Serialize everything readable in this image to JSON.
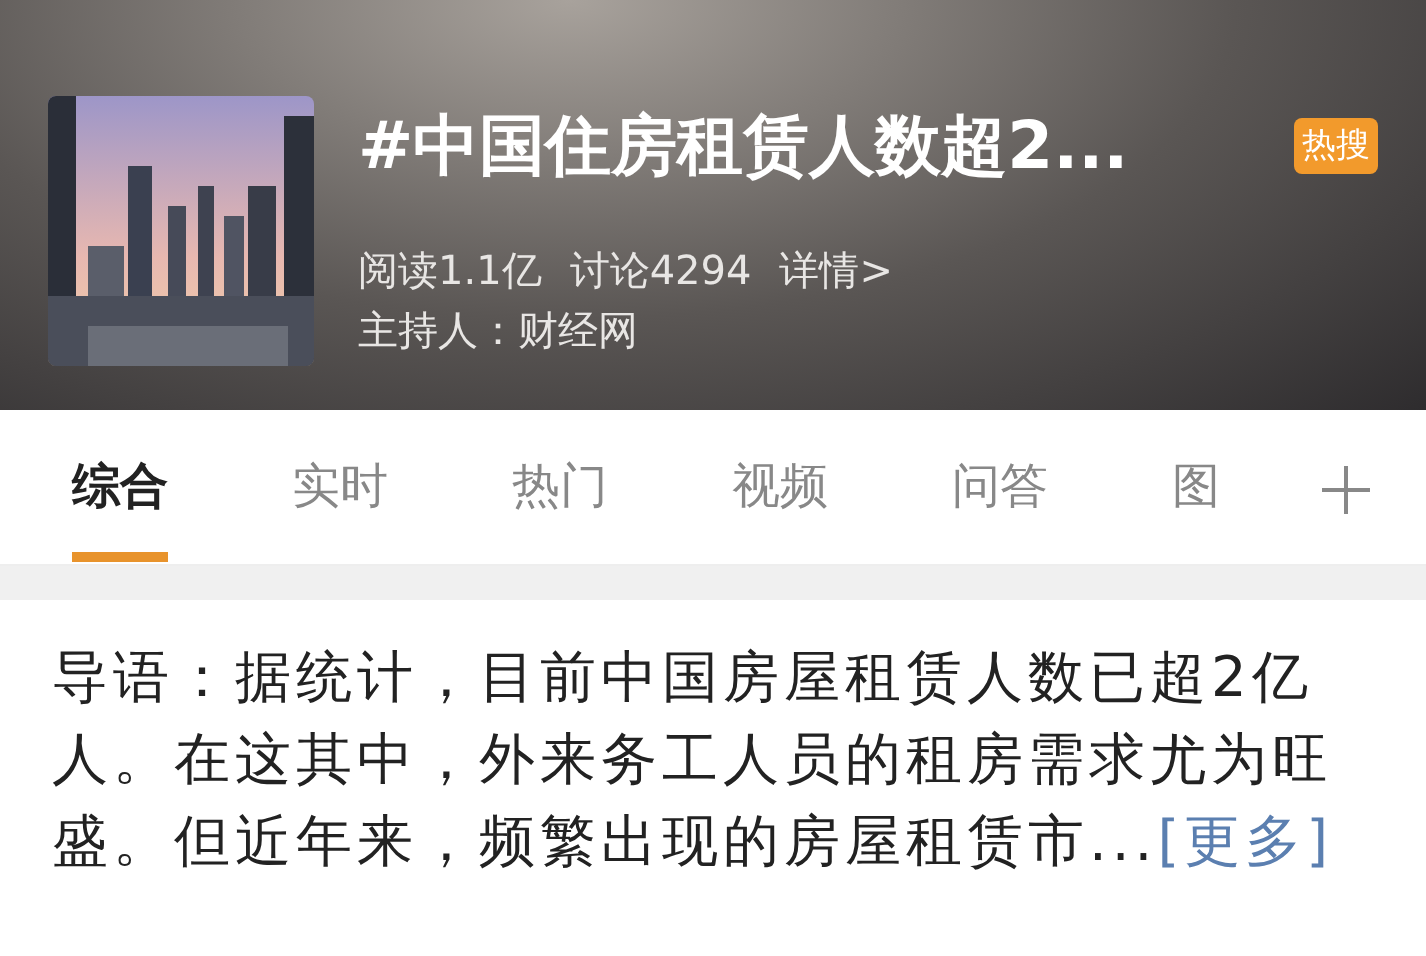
{
  "header": {
    "title": "#中国住房租赁人数超2...",
    "badge": "热搜",
    "reads": "阅读1.1亿",
    "discussions": "讨论4294",
    "details_link": "详情>",
    "host": "主持人：财经网"
  },
  "tabs": [
    {
      "label": "综合",
      "selected": true
    },
    {
      "label": "实时",
      "selected": false
    },
    {
      "label": "热门",
      "selected": false
    },
    {
      "label": "视频",
      "selected": false
    },
    {
      "label": "问答",
      "selected": false
    },
    {
      "label": "图",
      "selected": false
    }
  ],
  "intro": {
    "text": "导语：据统计，目前中国房屋租赁人数已超2亿人。在这其中，外来务工人员的租房需求尤为旺盛。但近年来，频繁出现的房屋租赁市...",
    "more_link": "[更多]"
  }
}
